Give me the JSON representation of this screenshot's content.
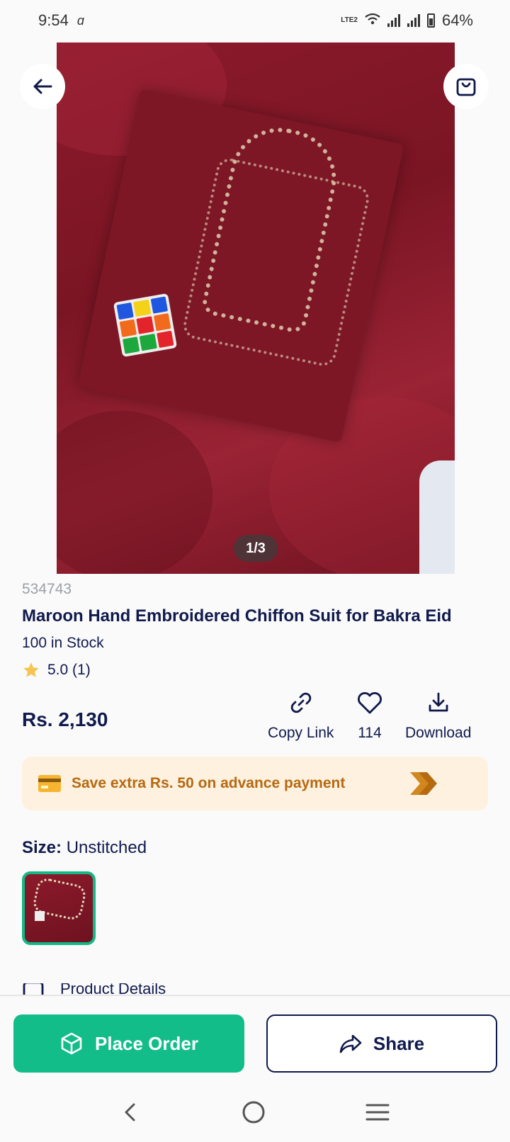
{
  "status": {
    "time": "9:54",
    "network": "LTE2",
    "battery": "64%"
  },
  "gallery": {
    "pager": "1/3"
  },
  "product": {
    "sku": "534743",
    "title": "Maroon Hand Embroidered Chiffon Suit for Bakra Eid",
    "stock": "100 in Stock",
    "rating": "5.0 (1)",
    "rating_value": 5.0,
    "price": "Rs. 2,130"
  },
  "actions": {
    "copy_link": "Copy Link",
    "likes": "114",
    "download": "Download"
  },
  "promo": {
    "text": "Save extra Rs. 50 on advance payment"
  },
  "size": {
    "label": "Size:",
    "value": "Unstitched"
  },
  "section_peek": "Product Details",
  "buttons": {
    "place_order": "Place Order",
    "share": "Share"
  },
  "colors": {
    "accent": "#13bd89",
    "navy": "#101a4d",
    "promo_bg": "#fff1df",
    "promo_text": "#b56a12",
    "star": "#f5c451"
  }
}
